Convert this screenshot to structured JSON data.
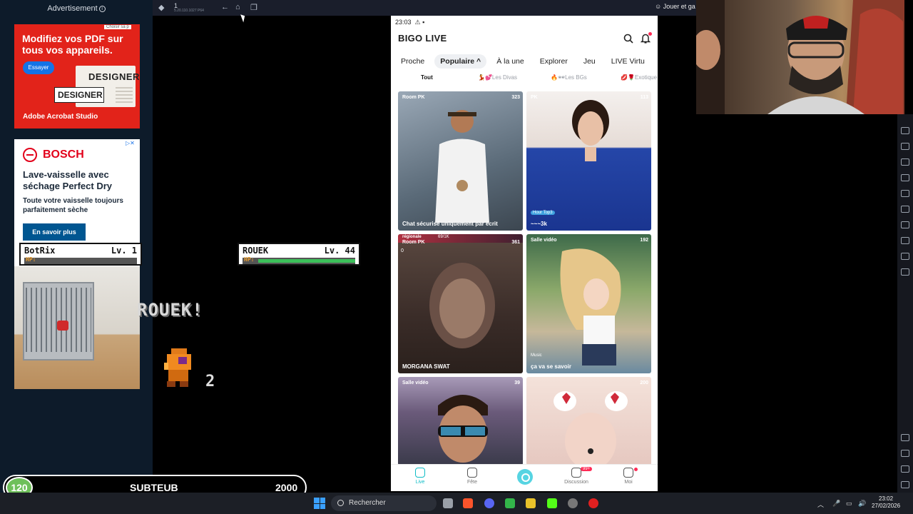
{
  "ads": {
    "header": "Advertisement",
    "adobe": {
      "headline": "Modifiez vos PDF sur tous vos appareils.",
      "cta": "Essayer",
      "tag": "Choisir sa p",
      "design1": "DESIGNER",
      "design2": "DESIGNER",
      "brand": "Adobe Acrobat Studio"
    },
    "bosch": {
      "brand": "BOSCH",
      "headline": "Lave-vaisselle avec séchage Perfect Dry",
      "sub": "Toute votre vaisselle toujours parfaitement sèche",
      "cta": "En savoir plus"
    }
  },
  "game": {
    "player": {
      "name": "BotRix",
      "level": "Lv. 1",
      "hp_label": "HP:",
      "hp_fraction": 0
    },
    "enemy": {
      "name": "ROUEK",
      "level": "Lv. 44",
      "hp_label": "HP:",
      "hp_fraction": 1
    },
    "message": "ROUEK!",
    "sprite_number": "2"
  },
  "emulator": {
    "title": "1",
    "subtitle": "5.20.110.1027 P64",
    "play_label": "Jouer et ga"
  },
  "phone": {
    "time": "23:03",
    "logo": "BIGO LIVE",
    "tabs": [
      "Proche",
      "Populaire ^",
      "À la une",
      "Explorer",
      "Jeu",
      "LIVE Virtu"
    ],
    "active_tab": "Populaire ^",
    "subtabs": [
      "Tout",
      "💃💕Les Divas",
      "🔥🕶Les BGs",
      "💋🌹Exotique"
    ],
    "cards": [
      {
        "tag": "Room PK",
        "viewers": "323",
        "caption": "Chat sécurisé uniquement par écrit",
        "color": "#8d9aa8"
      },
      {
        "tag": "PK",
        "viewers": "113",
        "caption": "~~~3k",
        "badge": "Hour Top3",
        "color": "#2546a8"
      },
      {
        "tag": "Room PK",
        "viewers": "361",
        "caption": "MORGANA SWAT",
        "extra": "69/1K",
        "extra2": "régionale",
        "zero": "0",
        "color": "#4a3a36"
      },
      {
        "tag": "Salle vidéo",
        "viewers": "192",
        "caption": "ça va se savoir",
        "badge": "Music",
        "color": "#7a8c58"
      },
      {
        "tag": "Salle vidéo",
        "viewers": "39",
        "caption": "",
        "color": "#6b5a70"
      },
      {
        "tag": "",
        "viewers": "200",
        "caption": "",
        "color": "#e8cfc8"
      }
    ],
    "nav": {
      "live": "Live",
      "fete": "Fête",
      "discussion": "Discussion",
      "moi": "Moi",
      "badge": "99+"
    }
  },
  "sub_counter": {
    "count": "120",
    "label": "SUBTEUB",
    "goal": "2000"
  },
  "taskbar": {
    "search": "Rechercher",
    "time": "23:02",
    "date": "27/02/2026"
  },
  "colors": {
    "hp_green": "#3cc05a",
    "bigo_accent": "#0dbcc6",
    "adobe_red": "#e2231a",
    "bosch_red": "#e2001a",
    "sub_green": "#6ec05a"
  }
}
